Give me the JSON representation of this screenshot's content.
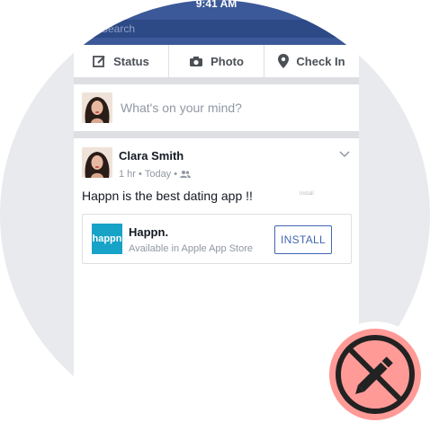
{
  "status_bar": {
    "time": "9:41 AM"
  },
  "search": {
    "placeholder": "Search"
  },
  "actions": [
    {
      "label": "Status",
      "icon": "edit-icon"
    },
    {
      "label": "Photo",
      "icon": "camera-icon"
    },
    {
      "label": "Check In",
      "icon": "location-pin-icon"
    }
  ],
  "composer": {
    "placeholder": "What's on your mind?"
  },
  "post": {
    "author": "Clara Smith",
    "time": "1 hr",
    "separator": "•",
    "date": "Today",
    "text": "Happn is the best dating app !!",
    "tiny_label": "Install"
  },
  "ad": {
    "logo_text": "happn",
    "name": "Happn.",
    "subtitle": "Available in Apple App Store",
    "button_label": "INSTALL"
  },
  "badge": {
    "icon": "no-editing-icon"
  },
  "colors": {
    "header": "#3b5998",
    "accent": "#4267b2",
    "happn": "#17a2c8",
    "badge": "#ff9a97"
  }
}
